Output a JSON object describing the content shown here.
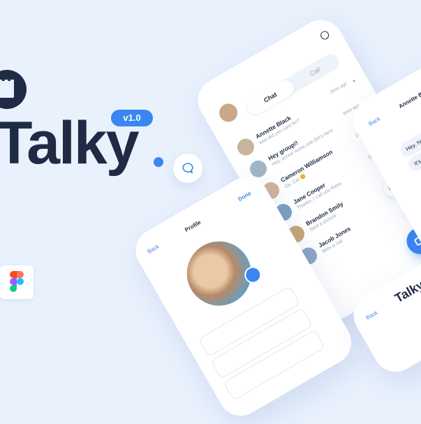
{
  "brand": {
    "title": "Talky",
    "version": "v1.0"
  },
  "colors": {
    "accent": "#3a86f2",
    "text": "#1f2a44",
    "bg": "#e9f1fd"
  },
  "icons": {
    "logo": "rook-icon",
    "figma": "figma-icon",
    "chat": "chat-bubble-icon",
    "video": "video-camera-icon"
  },
  "chat_screen": {
    "search_icon": "search-icon",
    "tabs": [
      "Chat",
      "Call"
    ],
    "conversations": [
      {
        "name": "Annette Black",
        "message": "was did you cant for?",
        "time": "3min ago"
      },
      {
        "name": "Hey group!!",
        "message": "Hey, soooo some one (let's here",
        "time": "3min ago"
      },
      {
        "name": "Cameron Williamson",
        "message": "Ok, Cal 😊",
        "time": "12:18 pm"
      },
      {
        "name": "Jane Cooper",
        "message": "Thanks, I call you there",
        "time": "12:18 pm"
      },
      {
        "name": "Brandon Smily",
        "message": "Sent a picture",
        "time": ""
      },
      {
        "name": "Jacob Jones",
        "message": "Miss a call",
        "time": ""
      }
    ]
  },
  "conversation_screen": {
    "back": "Back",
    "contact": "Annette Black",
    "messages": [
      "Hey, hey, hey...",
      "It's morning here 🙂"
    ]
  },
  "profile_screen": {
    "back": "Back",
    "title": "Profile",
    "done": "Done"
  },
  "bottom_screen": {
    "back": "Back",
    "title": "Talky."
  }
}
